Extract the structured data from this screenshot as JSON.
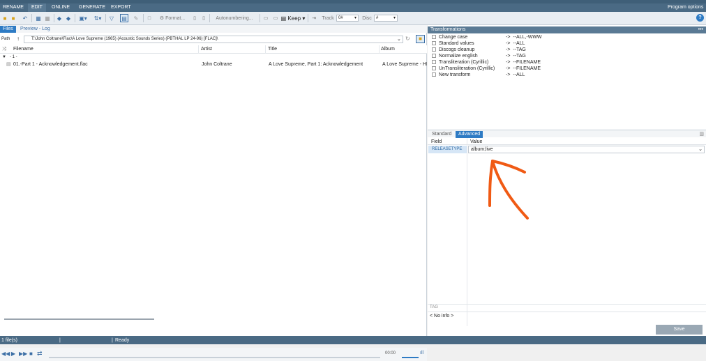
{
  "menu": {
    "items": [
      "RENAME",
      "EDIT",
      "ONLINE",
      "GENERATE",
      "EXPORT"
    ],
    "active_index": 1,
    "program_options": "Program options"
  },
  "toolbar": {
    "format_label": "Format...",
    "autonumbering_label": "Autonumbering...",
    "keep_label": "Keep",
    "track_label": "Track",
    "track_value": "0#",
    "disc_label": "Disc",
    "disc_value": "#"
  },
  "left": {
    "tabs": [
      "Files",
      "Preview - Log"
    ],
    "path_label": "Path",
    "path_value": "T:\\John Coltrane\\Flac\\A Love Supreme (1965) (Acoustic Sounds Series) (PBTHAL LP 24-96) [FLAC]\\",
    "columns": [
      "Filename",
      "Artist",
      "Title",
      "Album"
    ],
    "group_label": "- 1 -",
    "rows": [
      {
        "filename": "01.-Part 1 - Acknowledgement.flac",
        "artist": "John Coltrane",
        "title": "A Love Supreme, Part 1: Acknowledgement",
        "album": "A Love Supreme - HD"
      }
    ],
    "player_time": "00:00"
  },
  "right": {
    "transformations_title": "Transformations",
    "transformations": [
      {
        "name": "Change case",
        "target": "--ALL,-WWW"
      },
      {
        "name": "Standard values",
        "target": "--ALL"
      },
      {
        "name": "Discogs cleanup",
        "target": "--TAG"
      },
      {
        "name": "Normalize english",
        "target": "--TAG"
      },
      {
        "name": "Transliteration (Cyrillic)",
        "target": "--FILENAME"
      },
      {
        "name": "UnTransliteration (Cyrillic)",
        "target": "--FILENAME"
      },
      {
        "name": "New transform",
        "target": "--ALL"
      }
    ],
    "arrow_glyph": "->",
    "tabs": [
      "Standard",
      "Advanced"
    ],
    "field_header": "Field",
    "value_header": "Value",
    "field_name": "RELEASETYPE",
    "field_value": "album;live",
    "tag_label": "TAG",
    "no_info": "< No info >",
    "save_label": "Save"
  },
  "status": {
    "files": "1 file(s)",
    "state": "Ready"
  },
  "colors": {
    "accent": "#2e7bc4",
    "menu_bg": "#4a6a84",
    "annotation": "#f05a14"
  }
}
